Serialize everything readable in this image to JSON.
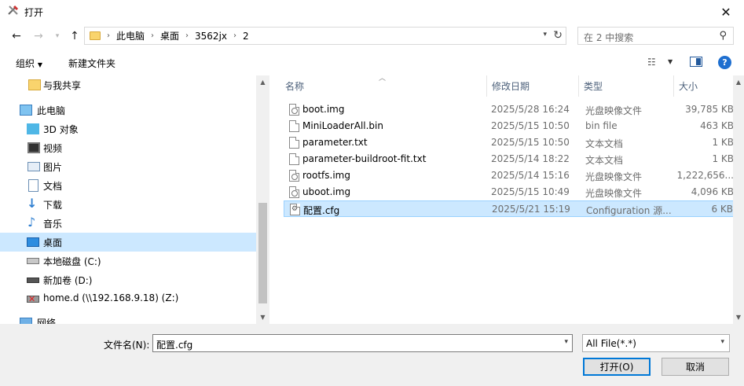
{
  "window": {
    "title": "打开"
  },
  "address": {
    "crumbs": [
      "此电脑",
      "桌面",
      "3562jx",
      "2"
    ]
  },
  "search": {
    "placeholder": "在 2 中搜索"
  },
  "toolbar": {
    "organize": "组织",
    "new_folder": "新建文件夹"
  },
  "nav": {
    "items": [
      {
        "label": "与我共享",
        "icon": "shared-folder-icon"
      },
      {
        "label": "此电脑",
        "icon": "computer-icon"
      },
      {
        "label": "3D 对象",
        "icon": "3d-objects-icon"
      },
      {
        "label": "视频",
        "icon": "video-icon"
      },
      {
        "label": "图片",
        "icon": "pictures-icon"
      },
      {
        "label": "文档",
        "icon": "documents-icon"
      },
      {
        "label": "下载",
        "icon": "download-icon"
      },
      {
        "label": "音乐",
        "icon": "music-icon"
      },
      {
        "label": "桌面",
        "icon": "desktop-icon",
        "selected": true
      },
      {
        "label": "本地磁盘 (C:)",
        "icon": "local-disk-icon"
      },
      {
        "label": "新加卷 (D:)",
        "icon": "drive-icon"
      },
      {
        "label": "home.d (\\\\192.168.9.18) (Z:)",
        "icon": "network-drive-disconnected-icon"
      },
      {
        "label": "网络",
        "icon": "network-icon"
      }
    ]
  },
  "columns": {
    "name": "名称",
    "modified": "修改日期",
    "type": "类型",
    "size": "大小"
  },
  "files": [
    {
      "name": "boot.img",
      "modified": "2025/5/28 16:24",
      "type": "光盘映像文件",
      "size": "39,785 KB",
      "icon": "disc-image-icon"
    },
    {
      "name": "MiniLoaderAll.bin",
      "modified": "2025/5/15 10:50",
      "type": "bin file",
      "size": "463 KB",
      "icon": "file-icon"
    },
    {
      "name": "parameter.txt",
      "modified": "2025/5/15 10:50",
      "type": "文本文档",
      "size": "1 KB",
      "icon": "text-file-icon"
    },
    {
      "name": "parameter-buildroot-fit.txt",
      "modified": "2025/5/14 18:22",
      "type": "文本文档",
      "size": "1 KB",
      "icon": "text-file-icon"
    },
    {
      "name": "rootfs.img",
      "modified": "2025/5/14 15:16",
      "type": "光盘映像文件",
      "size": "1,222,656...",
      "icon": "disc-image-icon"
    },
    {
      "name": "uboot.img",
      "modified": "2025/5/15 10:49",
      "type": "光盘映像文件",
      "size": "4,096 KB",
      "icon": "disc-image-icon"
    },
    {
      "name": "配置.cfg",
      "modified": "2025/5/21 15:19",
      "type": "Configuration 源...",
      "size": "6 KB",
      "icon": "config-file-icon",
      "selected": true
    }
  ],
  "bottom": {
    "filename_label": "文件名(N):",
    "filename_value": "配置.cfg",
    "filter_value": "All File(*.*)",
    "open_label": "打开(O)",
    "cancel_label": "取消"
  }
}
